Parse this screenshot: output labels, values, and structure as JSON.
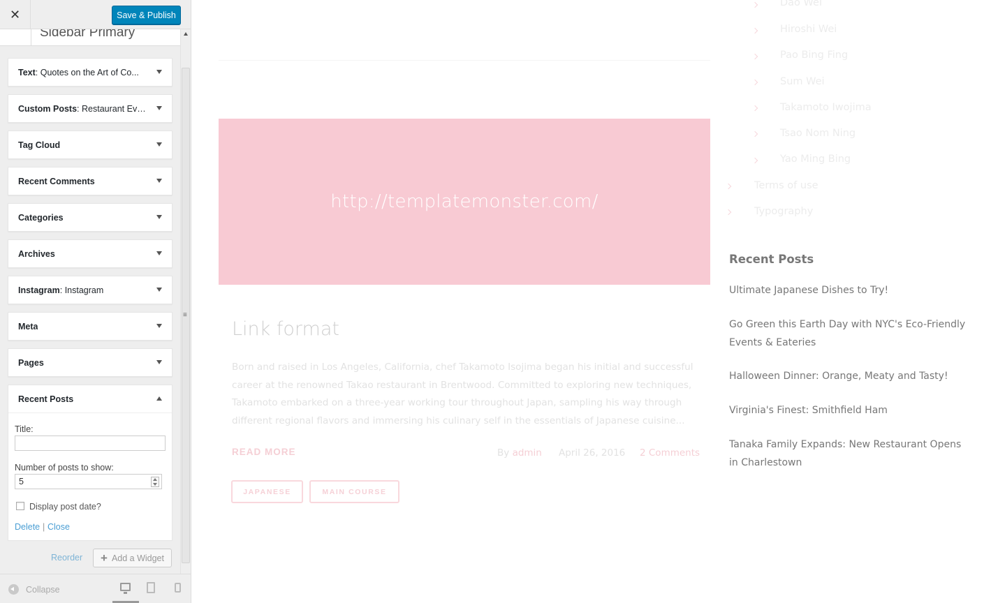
{
  "customizer": {
    "close_glyph": "✕",
    "save_label": "Save & Publish",
    "section_title": "Sidebar Primary",
    "widgets": [
      {
        "type": "Text",
        "title": "Quotes on the Art of Co..."
      },
      {
        "type": "Custom Posts",
        "title": "Restaurant Eve..."
      },
      {
        "type": "Tag Cloud",
        "title": ""
      },
      {
        "type": "Recent Comments",
        "title": ""
      },
      {
        "type": "Categories",
        "title": ""
      },
      {
        "type": "Archives",
        "title": ""
      },
      {
        "type": "Instagram",
        "title": "Instagram"
      },
      {
        "type": "Meta",
        "title": ""
      },
      {
        "type": "Pages",
        "title": ""
      }
    ],
    "open_widget": {
      "name": "Recent Posts",
      "title_label": "Title:",
      "title_value": "",
      "number_label": "Number of posts to show:",
      "number_value": "5",
      "show_date_label": "Display post date?",
      "show_date_checked": false,
      "delete_label": "Delete",
      "separator": "|",
      "close_label": "Close"
    },
    "reorder_label": "Reorder",
    "add_widget_label": "Add a Widget",
    "collapse_label": "Collapse",
    "accent_color": "#0085ba"
  },
  "preview": {
    "post": {
      "image_url_text": "http://templatemonster.com/",
      "image_color": "#f8cad3",
      "title": "Link format",
      "excerpt": "Born and raised in Los Angeles, California, chef Takamoto Isojima began his initial and successful career at the renowned Takao restaurant in Brentwood. Committed to exploring new techniques, Takamoto embarked on a three-year working tour throughout Japan, sampling his way through different regional flavors and immersing his culinary self in the essentials of Japanese cuisine...",
      "read_more": "READ MORE",
      "by_label": "By",
      "author": "admin",
      "date": "April 26, 2016",
      "comments": "2 Comments",
      "tags": [
        "JAPANESE",
        "MAIN COURSE"
      ]
    },
    "page_list": {
      "sub_items": [
        "Dao Wei",
        "Hiroshi Wei",
        "Pao Bing Fing",
        "Sum Wei",
        "Takamoto Iwojima",
        "Tsao Nom Ning",
        "Yao Ming Bing"
      ],
      "top_items": [
        "Terms of use",
        "Typography"
      ]
    },
    "recent_posts": {
      "heading": "Recent Posts",
      "items": [
        "Ultimate Japanese Dishes to Try!",
        "Go Green this Earth Day with NYC's Eco-Friendly Events & Eateries",
        "Halloween Dinner: Orange, Meaty and Tasty!",
        "Virginia's Finest: Smithfield Ham",
        "Tanaka Family Expands: New Restaurant Opens in Charlestown"
      ]
    }
  }
}
